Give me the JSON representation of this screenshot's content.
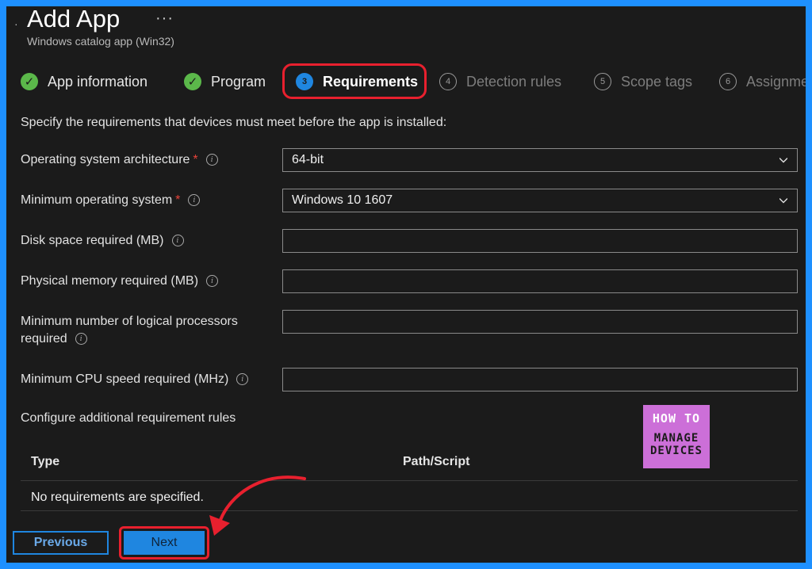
{
  "header": {
    "title": "Add App",
    "more_glyph": "···",
    "subtitle": "Windows catalog app (Win32)"
  },
  "steps": [
    {
      "number": "",
      "label": "App information",
      "status": "done"
    },
    {
      "number": "",
      "label": "Program",
      "status": "done"
    },
    {
      "number": "3",
      "label": "Requirements",
      "status": "current"
    },
    {
      "number": "4",
      "label": "Detection rules",
      "status": "pending"
    },
    {
      "number": "5",
      "label": "Scope tags",
      "status": "pending"
    },
    {
      "number": "6",
      "label": "Assignme",
      "status": "pending"
    }
  ],
  "intro": "Specify the requirements that devices must meet before the app is installed:",
  "form": {
    "os_architecture": {
      "label": "Operating system architecture",
      "required": "*",
      "value": "64-bit"
    },
    "min_os": {
      "label": "Minimum operating system",
      "required": "*",
      "value": "Windows 10 1607"
    },
    "disk_space": {
      "label": "Disk space required (MB)",
      "value": ""
    },
    "physical_memory": {
      "label": "Physical memory required (MB)",
      "value": ""
    },
    "logical_processors": {
      "label_line1": "Minimum number of logical processors",
      "label_line2": "required",
      "value": ""
    },
    "cpu_speed": {
      "label": "Minimum CPU speed required (MHz)",
      "value": ""
    }
  },
  "additional_rules": {
    "label": "Configure additional requirement rules",
    "columns": [
      "Type",
      "Path/Script"
    ],
    "empty_message": "No requirements are specified."
  },
  "watermark": {
    "line1": "HOW TO",
    "line2": "MANAGE",
    "line3": "DEVICES"
  },
  "footer": {
    "previous_label": "Previous",
    "next_label": "Next"
  },
  "icons": {
    "check": "check-icon",
    "info": "info-icon",
    "chevron": "chevron-down-icon"
  },
  "colors": {
    "accent": "#1f86e0",
    "success": "#5bb84a",
    "highlight": "#e8202e",
    "required": "#e8433a"
  }
}
